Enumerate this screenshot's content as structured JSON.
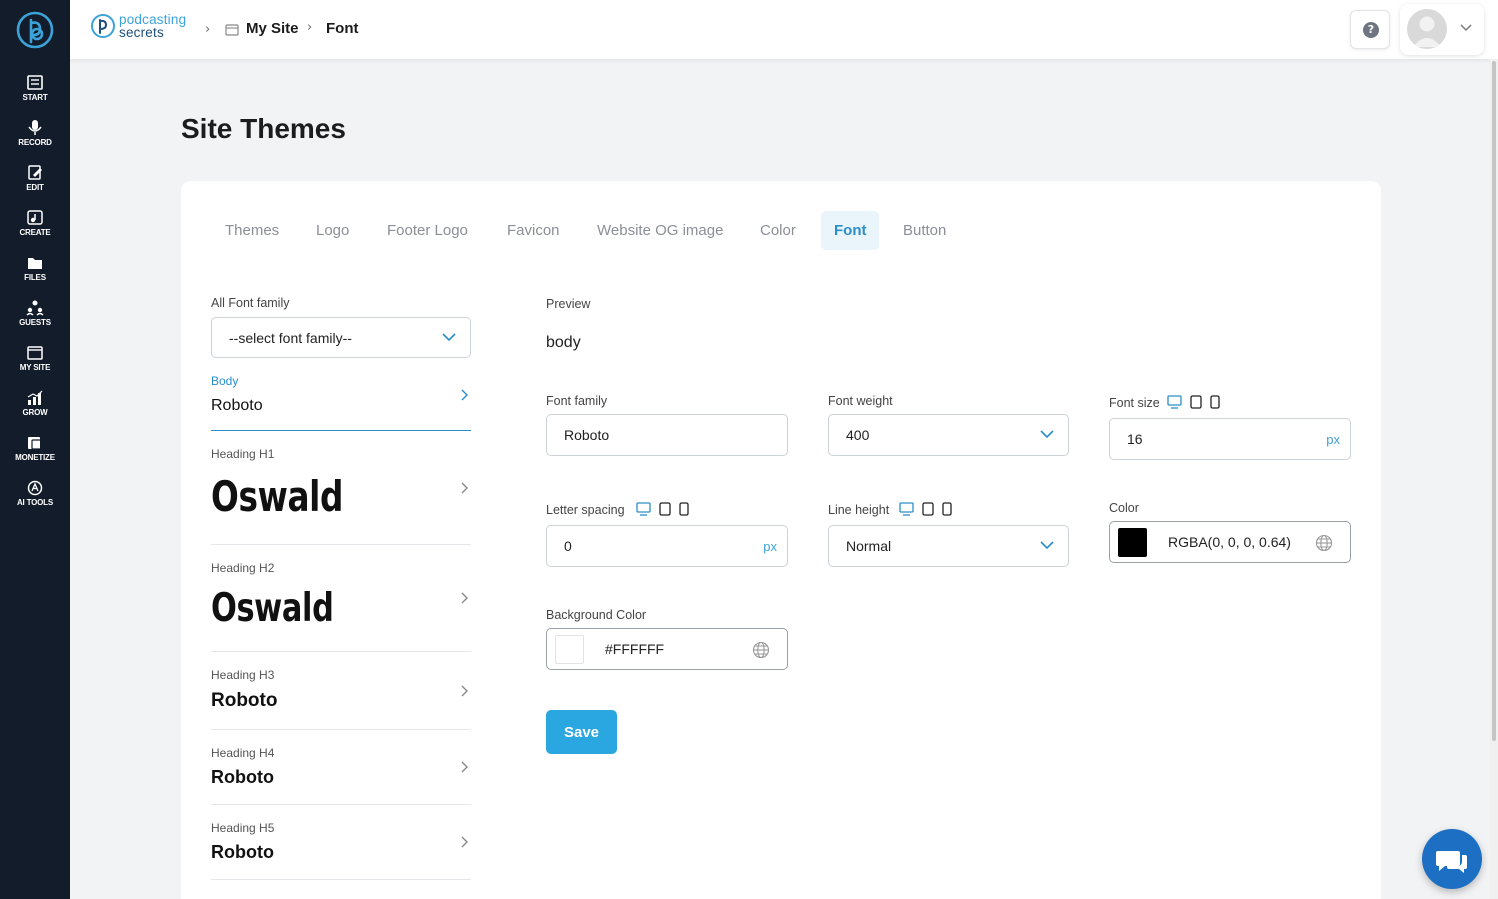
{
  "sidebar": {
    "items": [
      {
        "label": "START",
        "icon": "start-icon"
      },
      {
        "label": "RECORD",
        "icon": "microphone-icon"
      },
      {
        "label": "EDIT",
        "icon": "edit-icon"
      },
      {
        "label": "CREATE",
        "icon": "create-icon"
      },
      {
        "label": "FILES",
        "icon": "files-icon"
      },
      {
        "label": "GUESTS",
        "icon": "guests-icon"
      },
      {
        "label": "MY SITE",
        "icon": "site-icon"
      },
      {
        "label": "GROW",
        "icon": "chart-icon"
      },
      {
        "label": "MONETIZE",
        "icon": "monetize-icon"
      },
      {
        "label": "AI TOOLS",
        "icon": "ai-icon"
      }
    ]
  },
  "header": {
    "brand_line1": "podcasting",
    "brand_line2": "secrets",
    "breadcrumb": [
      "My Site",
      "Font"
    ]
  },
  "page": {
    "title": "Site Themes"
  },
  "tabs": [
    {
      "label": "Themes",
      "active": false
    },
    {
      "label": "Logo",
      "active": false
    },
    {
      "label": "Footer Logo",
      "active": false
    },
    {
      "label": "Favicon",
      "active": false
    },
    {
      "label": "Website OG image",
      "active": false
    },
    {
      "label": "Color",
      "active": false
    },
    {
      "label": "Font",
      "active": true
    },
    {
      "label": "Button",
      "active": false
    }
  ],
  "font_list": {
    "all_label": "All Font family",
    "select_placeholder": "--select font family--",
    "items": [
      {
        "label": "Body",
        "font": "Roboto",
        "selected": true
      },
      {
        "label": "Heading H1",
        "font": "Oswald",
        "selected": false
      },
      {
        "label": "Heading H2",
        "font": "Oswald",
        "selected": false
      },
      {
        "label": "Heading H3",
        "font": "Roboto",
        "selected": false
      },
      {
        "label": "Heading H4",
        "font": "Roboto",
        "selected": false
      },
      {
        "label": "Heading H5",
        "font": "Roboto",
        "selected": false
      }
    ]
  },
  "editor": {
    "preview_label": "Preview",
    "preview_text": "body",
    "font_family_label": "Font family",
    "font_family_value": "Roboto",
    "font_weight_label": "Font weight",
    "font_weight_value": "400",
    "font_size_label": "Font size",
    "font_size_value": "16",
    "font_size_unit": "px",
    "letter_spacing_label": "Letter spacing",
    "letter_spacing_value": "0",
    "letter_spacing_unit": "px",
    "line_height_label": "Line height",
    "line_height_value": "Normal",
    "color_label": "Color",
    "color_value": "RGBA(0, 0, 0, 0.64)",
    "color_swatch": "#000000",
    "bg_color_label": "Background Color",
    "bg_color_value": "#FFFFFF",
    "bg_swatch": "#FFFFFF",
    "save_label": "Save"
  },
  "colors": {
    "sidebar_bg": "#131c2b",
    "accent": "#2aa6e0",
    "active_tab_bg": "#e9f4fb",
    "chat_bubble": "#1d6fc4"
  }
}
